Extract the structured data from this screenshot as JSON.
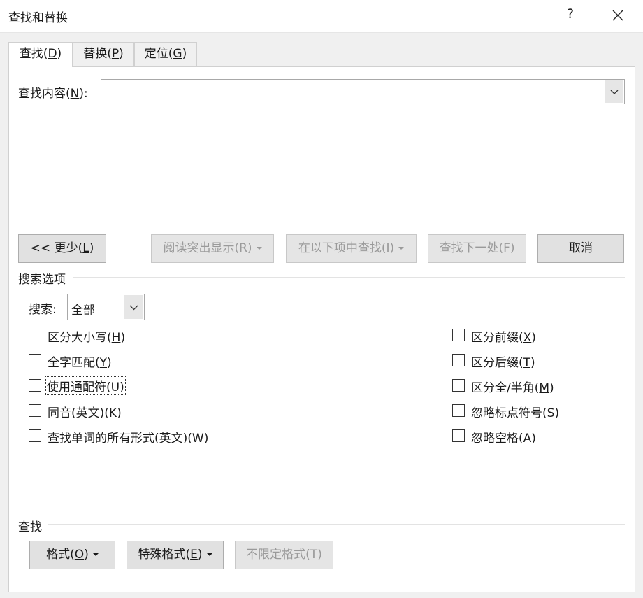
{
  "window": {
    "title": "查找和替换",
    "help_glyph": "?",
    "close_icon": "close-icon"
  },
  "tabs": [
    {
      "label": "查找(",
      "key": "D",
      "suffix": ")",
      "active": true
    },
    {
      "label": "替换(",
      "key": "P",
      "suffix": ")",
      "active": false
    },
    {
      "label": "定位(",
      "key": "G",
      "suffix": ")",
      "active": false
    }
  ],
  "find": {
    "label": "查找内容(",
    "key": "N",
    "suffix": "):",
    "value": ""
  },
  "buttons": {
    "less": {
      "prefix": "<< 更少(",
      "key": "L",
      "suffix": ")"
    },
    "highlight": "阅读突出显示(R)",
    "find_in": "在以下项中查找(I)",
    "find_next": "查找下一处(F)",
    "cancel": "取消"
  },
  "search_options": {
    "section_label": "搜索选项",
    "search_label": "搜索:",
    "search_value": "全部",
    "left": [
      {
        "label": "区分大小写(",
        "key": "H",
        "suffix": ")",
        "checked": false
      },
      {
        "label": "全字匹配(",
        "key": "Y",
        "suffix": ")",
        "checked": false
      },
      {
        "label": "使用通配符(",
        "key": "U",
        "suffix": ")",
        "checked": false,
        "focused": true
      },
      {
        "label": "同音(英文)(",
        "key": "K",
        "suffix": ")",
        "checked": false
      },
      {
        "label": "查找单词的所有形式(英文)(",
        "key": "W",
        "suffix": ")",
        "checked": false
      }
    ],
    "right": [
      {
        "label": "区分前缀(",
        "key": "X",
        "suffix": ")",
        "checked": false
      },
      {
        "label": "区分后缀(",
        "key": "T",
        "suffix": ")",
        "checked": false
      },
      {
        "label": "区分全/半角(",
        "key": "M",
        "suffix": ")",
        "checked": false
      },
      {
        "label": "忽略标点符号(",
        "key": "S",
        "suffix": ")",
        "checked": false
      },
      {
        "label": "忽略空格(",
        "key": "A",
        "suffix": ")",
        "checked": false
      }
    ]
  },
  "find_section": {
    "label": "查找",
    "format": {
      "label": "格式(",
      "key": "O",
      "suffix": ")"
    },
    "special": {
      "label": "特殊格式(",
      "key": "E",
      "suffix": ")"
    },
    "no_format": "不限定格式(T)"
  }
}
